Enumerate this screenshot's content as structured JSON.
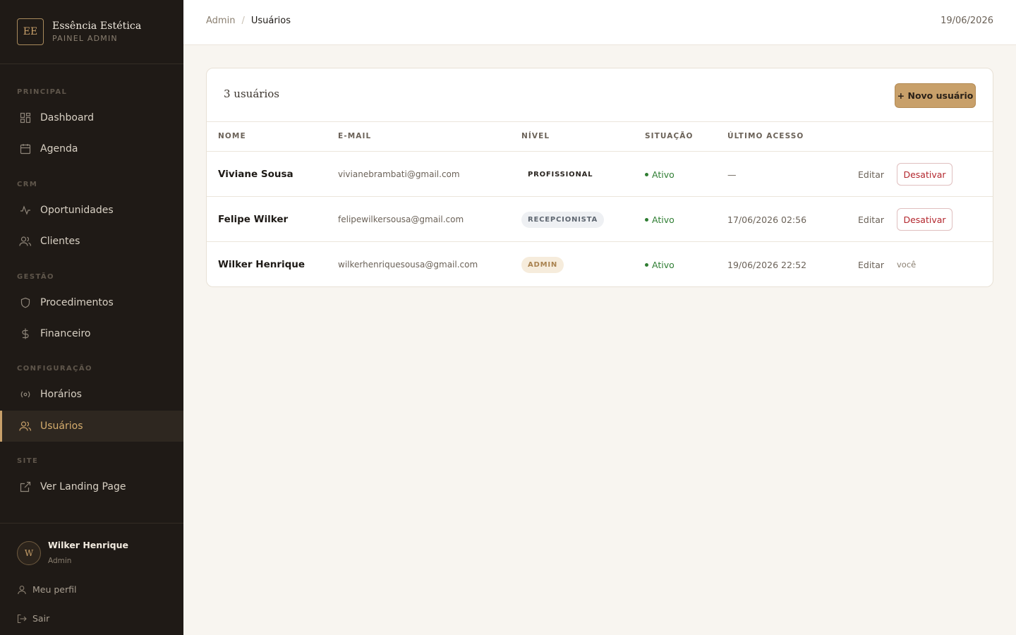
{
  "brand": {
    "logo": "EE",
    "name": "Essência Estética",
    "subtitle": "PAINEL ADMIN"
  },
  "sidebar": {
    "sections": [
      {
        "label": "PRINCIPAL",
        "items": [
          {
            "label": "Dashboard",
            "icon": "grid-icon"
          },
          {
            "label": "Agenda",
            "icon": "calendar-icon"
          }
        ]
      },
      {
        "label": "CRM",
        "items": [
          {
            "label": "Oportunidades",
            "icon": "activity-icon"
          },
          {
            "label": "Clientes",
            "icon": "users-icon"
          }
        ]
      },
      {
        "label": "GESTÃO",
        "items": [
          {
            "label": "Procedimentos",
            "icon": "shield-icon"
          },
          {
            "label": "Financeiro",
            "icon": "dollar-icon"
          }
        ]
      },
      {
        "label": "CONFIGURAÇÃO",
        "items": [
          {
            "label": "Horários",
            "icon": "radio-icon"
          },
          {
            "label": "Usuários",
            "icon": "users-icon",
            "active": true
          }
        ]
      },
      {
        "label": "SITE",
        "items": [
          {
            "label": "Ver Landing Page",
            "icon": "external-link-icon"
          }
        ]
      }
    ]
  },
  "user": {
    "avatar": "W",
    "name": "Wilker Henrique",
    "role": "Admin",
    "profile_label": "Meu perfil",
    "logout_label": "Sair"
  },
  "header": {
    "breadcrumb_root": "Admin",
    "breadcrumb_sep": "/",
    "breadcrumb_current": "Usuários",
    "date": "19/06/2026"
  },
  "card": {
    "title": "3 usuários",
    "new_button": "+ Novo usuário"
  },
  "table": {
    "headers": {
      "name": "NOME",
      "email": "E-MAIL",
      "level": "NÍVEL",
      "status": "SITUAÇÃO",
      "last": "ÚLTIMO ACESSO"
    },
    "rows": [
      {
        "name": "Viviane Sousa",
        "email": "vivianebrambati@gmail.com",
        "level": "PROFISSIONAL",
        "status": "Ativo",
        "last": "—",
        "edit": "Editar",
        "action": "Desativar"
      },
      {
        "name": "Felipe Wilker",
        "email": "felipewilkersousa@gmail.com",
        "level": "RECEPCIONISTA",
        "status": "Ativo",
        "last": "17/06/2026 02:56",
        "edit": "Editar",
        "action": "Desativar"
      },
      {
        "name": "Wilker Henrique",
        "email": "wilkerhenriquesousa@gmail.com",
        "level": "ADMIN",
        "status": "Ativo",
        "last": "19/06/2026 22:52",
        "edit": "Editar",
        "action": "você"
      }
    ]
  },
  "colors": {
    "accent": "#c8a06a",
    "sidebar_bg": "#1f1a16",
    "status_active": "#2e7d32",
    "danger": "#b3262d",
    "badge_profissional_bg": "#ffffff",
    "badge_recepcionista_bg": "#eef0f3",
    "badge_admin_bg": "#f6ecdc"
  }
}
